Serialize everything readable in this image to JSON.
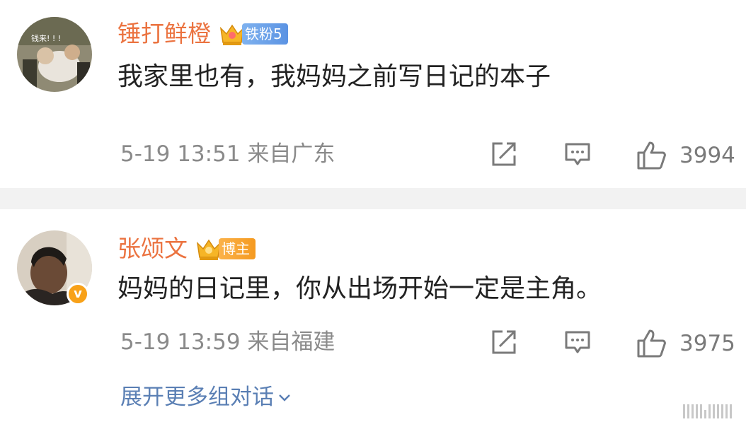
{
  "comments": [
    {
      "username": "锤打鲜橙",
      "badge": {
        "label": "铁粉5",
        "type": "iron-fan"
      },
      "avatar_caption": "钱来! ! !",
      "text": "我家里也有，我妈妈之前写日记的本子",
      "time": "5-19 13:51",
      "location": "来自广东",
      "likes": "3994",
      "icons": {
        "share": "share-icon",
        "reply": "comment-icon",
        "like": "thumbs-up-icon"
      }
    },
    {
      "username": "张颂文",
      "badge": {
        "label": "博主",
        "type": "blogger"
      },
      "verified_mark": "v",
      "text": "妈妈的日记里，你从出场开始一定是主角。",
      "time": "5-19 13:59",
      "location": "来自福建",
      "likes": "3975",
      "icons": {
        "share": "share-icon",
        "reply": "comment-icon",
        "like": "thumbs-up-icon"
      }
    }
  ],
  "expand_link": "展开更多组对话",
  "colors": {
    "username": "#eb7340",
    "meta": "#8a8a8a",
    "link": "#5a7fb4",
    "divider": "#f2f2f2",
    "iron_badge": "#5b93e3",
    "blogger_badge": "#f59a20"
  }
}
